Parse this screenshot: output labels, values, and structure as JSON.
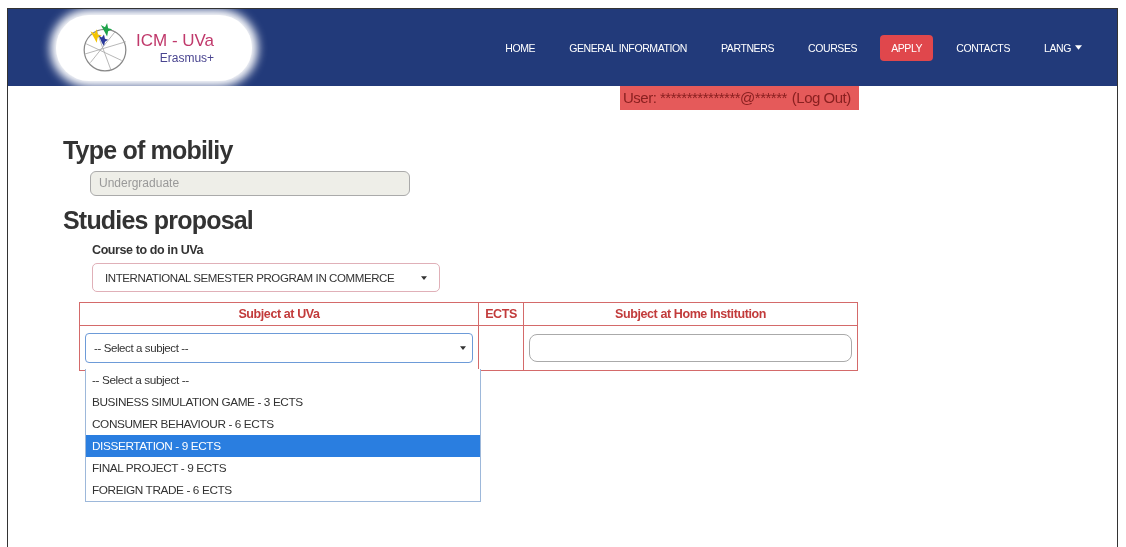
{
  "logo": {
    "title": "ICM - UVa",
    "subtitle": "Erasmus+"
  },
  "nav": [
    {
      "label": "HOME",
      "selected": false,
      "dropdown": false
    },
    {
      "label": "GENERAL INFORMATION",
      "selected": false,
      "dropdown": false
    },
    {
      "label": "PARTNERS",
      "selected": false,
      "dropdown": false
    },
    {
      "label": "COURSES",
      "selected": false,
      "dropdown": false
    },
    {
      "label": "APPLY",
      "selected": true,
      "dropdown": false
    },
    {
      "label": "CONTACTS",
      "selected": false,
      "dropdown": false
    },
    {
      "label": "LANG",
      "selected": false,
      "dropdown": true
    }
  ],
  "user_bar": {
    "text": "User: ***************@******",
    "link": "(Log Out)"
  },
  "mobility": {
    "heading": "Type of mobiliy",
    "value": "Undergraduate",
    "disabled": true
  },
  "studies": {
    "heading": "Studies proposal",
    "course_label": "Course to do in UVa",
    "course_value": "INTERNATIONAL SEMESTER PROGRAM IN COMMERCE",
    "table": {
      "columns": [
        "Subject at UVa",
        "ECTS",
        "Subject at Home Institution"
      ],
      "subject_select": "-- Select a subject --",
      "options": [
        {
          "label": "-- Select a subject --",
          "selected": false
        },
        {
          "label": "BUSINESS SIMULATION GAME - 3 ECTS",
          "selected": false
        },
        {
          "label": "CONSUMER BEHAVIOUR - 6 ECTS",
          "selected": false
        },
        {
          "label": "DISSERTATION - 9 ECTS",
          "selected": true
        },
        {
          "label": "FINAL PROJECT - 9 ECTS",
          "selected": false
        },
        {
          "label": "FOREIGN TRADE - 6 ECTS",
          "selected": false
        }
      ]
    }
  }
}
